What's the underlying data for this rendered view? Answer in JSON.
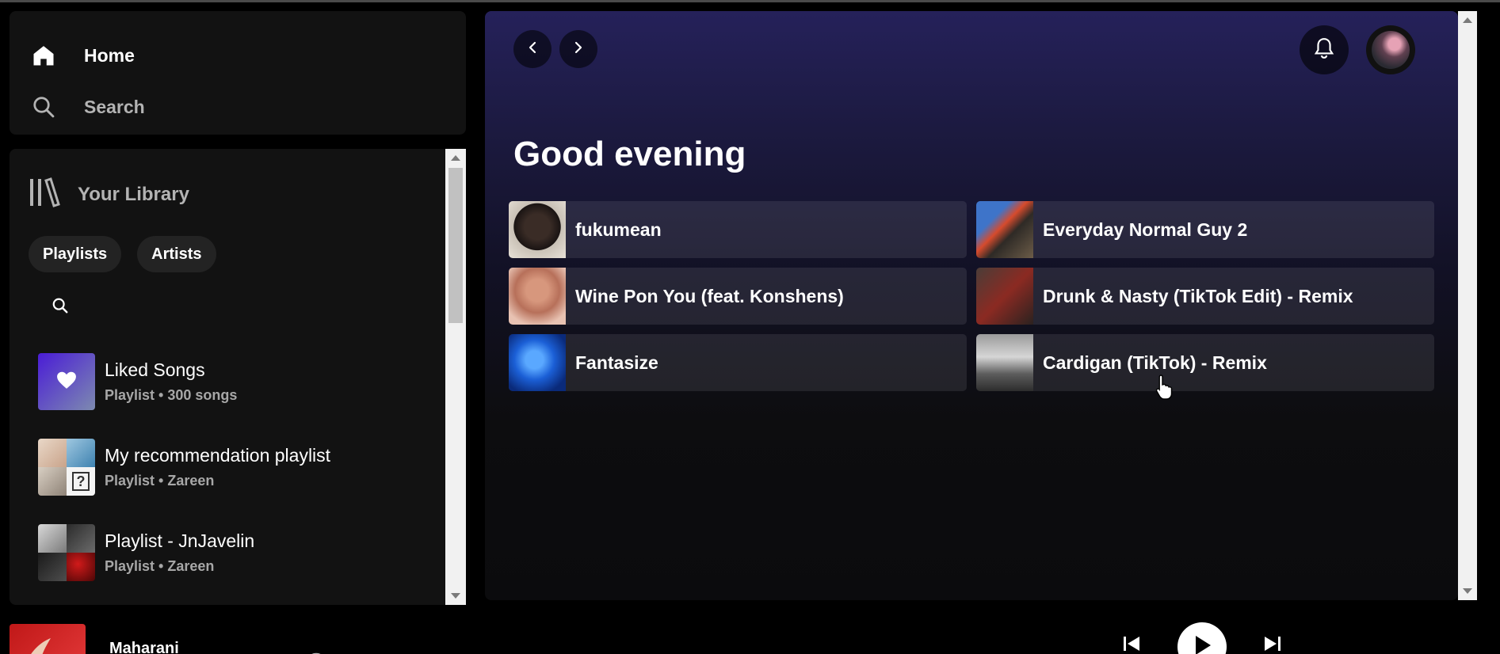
{
  "sidebar": {
    "home_label": "Home",
    "search_label": "Search",
    "home_icon": "home-icon",
    "search_icon": "search-icon"
  },
  "library": {
    "title": "Your Library",
    "filters": [
      "Playlists",
      "Artists"
    ],
    "items": [
      {
        "title": "Liked Songs",
        "subtitle": "Playlist • 300 songs"
      },
      {
        "title": "My recommendation playlist",
        "subtitle": "Playlist • Zareen"
      },
      {
        "title": "Playlist - JnJavelin",
        "subtitle": "Playlist • Zareen"
      }
    ]
  },
  "main": {
    "greeting": "Good evening",
    "cards": [
      {
        "title": "fukumean"
      },
      {
        "title": "Everyday Normal Guy 2"
      },
      {
        "title": "Wine Pon You (feat. Konshens)"
      },
      {
        "title": "Drunk & Nasty (TikTok Edit) - Remix"
      },
      {
        "title": "Fantasize"
      },
      {
        "title": "Cardigan (TikTok) - Remix"
      }
    ]
  },
  "player": {
    "track_title": "Maharani"
  },
  "colors": {
    "panel": "#121212",
    "main_gradient_top": "#25215a",
    "subtext": "#a7a7a7"
  }
}
